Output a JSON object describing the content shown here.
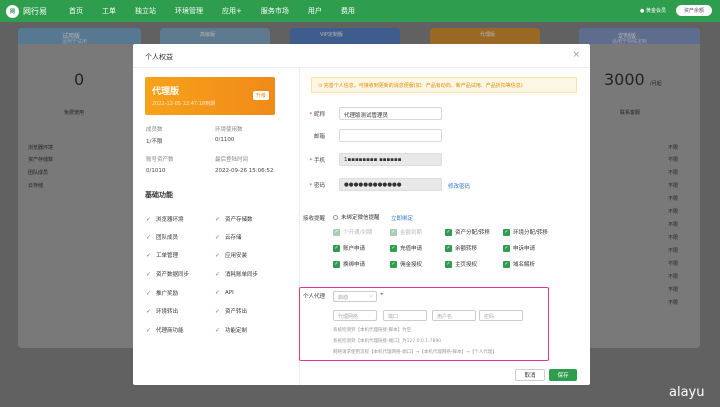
{
  "app": {
    "logo_text": "网行易",
    "account": "资产余额",
    "online": "● 黄金会员"
  },
  "nav": [
    "首页",
    "工单",
    "独立站",
    "环境管理",
    "应用+",
    "服务市场",
    "用户",
    "费用"
  ],
  "background": {
    "cards": [
      {
        "head": "试用版",
        "sub": "适用于试用",
        "price": "0",
        "btn": "免费使用"
      },
      {
        "head": "高级版",
        "sub": "",
        "price": "",
        "btn": ""
      },
      {
        "head": "VIP定制版",
        "sub": "",
        "price": "",
        "btn": ""
      },
      {
        "head": "代理版",
        "sub": "",
        "price": "",
        "btn": ""
      },
      {
        "head": "定制版",
        "sub": "适用于特殊定制",
        "price": "3000",
        "unit": "/月起",
        "btn": "联系客服"
      }
    ],
    "left_rows": [
      "浏览器环境",
      "资产存储数",
      "团队成员",
      "云存储"
    ],
    "right_rows": [
      "不限",
      "不限",
      "不限",
      "不限",
      "不限",
      "不限",
      "不限",
      "不限",
      "不限",
      "不限",
      "不限",
      "不限",
      "不限"
    ]
  },
  "modal": {
    "title": "个人权益",
    "close": "×",
    "plan": {
      "name": "代理版",
      "date": "2022-12-05 12:47:18到期",
      "upgrade": "升级"
    },
    "stats": [
      {
        "label": "成员数",
        "value": "1/不限"
      },
      {
        "label": "环境使用数",
        "value": "0/1100"
      },
      {
        "label": "账号资产数",
        "value": "0/1010"
      },
      {
        "label": "最后登陆时间",
        "value": "2022-09-26 15:06:52"
      }
    ],
    "features_title": "基础功能",
    "features": [
      "浏览器环境",
      "资产存储数",
      "团队成员",
      "云存储",
      "工单管理",
      "应用安装",
      "资产数据同步",
      "消耗账单同步",
      "推广奖励",
      "API",
      "环境转出",
      "资产转出",
      "代理商功能",
      "功能定制"
    ],
    "notice": "⊙ 完善个人信息，可接收到更新的消息便服(如：产品有动向、新产品试用、产品折扣等信息)",
    "form": {
      "nickname_label": "昵称",
      "nickname": "代理版测试管理员",
      "email_label": "邮箱",
      "email": "",
      "phone_label": "手机",
      "phone": "1▪▪▪▪▪▪▪▪ ▪▪▪▪▪▪",
      "password_label": "密码",
      "password": "●●●●●●●●●●●●",
      "change_pwd": "修改密码"
    },
    "receive": {
      "label": "接收提醒",
      "unbound": "未绑定微信提醒",
      "bind": "立即绑定"
    },
    "checkboxes": [
      {
        "label": "个开通/到期",
        "disabled": true
      },
      {
        "label": "金额到期",
        "disabled": true
      },
      {
        "label": "资产分配/转移",
        "disabled": false
      },
      {
        "label": "环境分配/转移",
        "disabled": false
      },
      {
        "label": "账户申请",
        "disabled": false
      },
      {
        "label": "充值申请",
        "disabled": false
      },
      {
        "label": "余额转移",
        "disabled": false
      },
      {
        "label": "申诉申请",
        "disabled": false
      },
      {
        "label": "换绑申请",
        "disabled": false
      },
      {
        "label": "佣金授权",
        "disabled": false
      },
      {
        "label": "主页授权",
        "disabled": false
      },
      {
        "label": "域名解析",
        "disabled": false
      }
    ],
    "proxy": {
      "label": "个人代理",
      "select": "启动",
      "inputs": [
        "代理网络",
        "端口",
        "用户名",
        "密码"
      ],
      "hints": [
        "系统检测到【本机代理链接-脚本】为空",
        "系统检测到【本机代理链接-端口】为127.0.0.1:7890",
        "网络请求使用流程【本机代理网络-端口】→【本机代理网络-脚本】→【个人代理】"
      ]
    },
    "buttons": {
      "cancel": "取消",
      "save": "保存"
    }
  },
  "watermark": "alayu"
}
